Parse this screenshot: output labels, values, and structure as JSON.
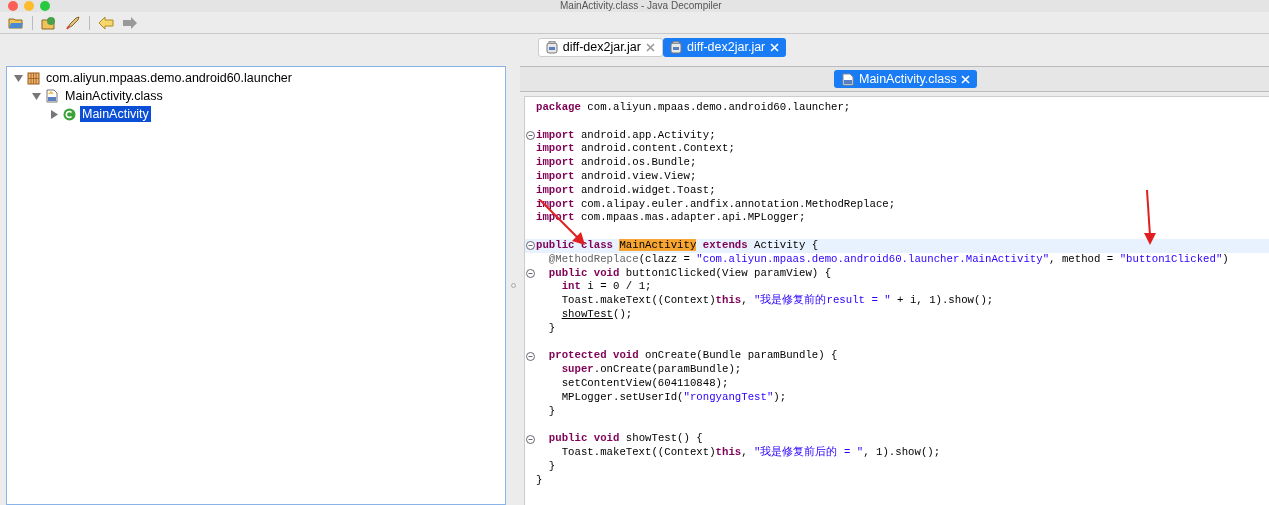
{
  "window": {
    "title": "MainActivity.class - Java Decompiler"
  },
  "file_tabs": [
    {
      "label": "diff-dex2jar.jar",
      "selected": false
    },
    {
      "label": "diff-dex2jar.jar",
      "selected": true
    }
  ],
  "tree": [
    {
      "label": "com.aliyun.mpaas.demo.android60.launcher",
      "kind": "package",
      "expanded": true,
      "selected": false,
      "children": [
        {
          "label": "MainActivity.class",
          "kind": "classfile",
          "expanded": true,
          "selected": false,
          "children": [
            {
              "label": "MainActivity",
              "kind": "class",
              "expanded": false,
              "selected": true
            }
          ]
        }
      ]
    }
  ],
  "editor_tabs": [
    {
      "label": "MainActivity.class",
      "selected": true
    }
  ],
  "code": [
    {
      "fold": false,
      "current": false,
      "tokens": [
        {
          "kind": "keyword",
          "text": "package"
        },
        {
          "kind": "plain",
          "text": " com.aliyun.mpaas.demo.android60.launcher;"
        }
      ]
    },
    {
      "fold": false,
      "current": false
    },
    {
      "fold": true,
      "current": false,
      "tokens": [
        {
          "kind": "keyword",
          "text": "import"
        },
        {
          "kind": "plain",
          "text": " android.app.Activity;"
        }
      ]
    },
    {
      "fold": false,
      "current": false,
      "tokens": [
        {
          "kind": "keyword",
          "text": "import"
        },
        {
          "kind": "plain",
          "text": " android.content.Context;"
        }
      ]
    },
    {
      "fold": false,
      "current": false,
      "tokens": [
        {
          "kind": "keyword",
          "text": "import"
        },
        {
          "kind": "plain",
          "text": " android.os.Bundle;"
        }
      ]
    },
    {
      "fold": false,
      "current": false,
      "tokens": [
        {
          "kind": "keyword",
          "text": "import"
        },
        {
          "kind": "plain",
          "text": " android.view.View;"
        }
      ]
    },
    {
      "fold": false,
      "current": false,
      "tokens": [
        {
          "kind": "keyword",
          "text": "import"
        },
        {
          "kind": "plain",
          "text": " android.widget.Toast;"
        }
      ]
    },
    {
      "fold": false,
      "current": false,
      "tokens": [
        {
          "kind": "keyword",
          "text": "import"
        },
        {
          "kind": "plain",
          "text": " com.alipay.euler.andfix.annotation.MethodReplace;"
        }
      ]
    },
    {
      "fold": false,
      "current": false,
      "tokens": [
        {
          "kind": "keyword",
          "text": "import"
        },
        {
          "kind": "plain",
          "text": " com.mpaas.mas.adapter.api.MPLogger;"
        }
      ]
    },
    {
      "fold": false,
      "current": false
    },
    {
      "fold": true,
      "current": true,
      "tokens": [
        {
          "kind": "keyword",
          "text": "public class "
        },
        {
          "kind": "highlight",
          "text": "MainActivity"
        },
        {
          "kind": "keyword",
          "text": " extends"
        },
        {
          "kind": "plain",
          "text": " Activity {"
        }
      ]
    },
    {
      "fold": false,
      "current": false,
      "tokens": [
        {
          "kind": "annotation",
          "text": "  @MethodReplace"
        },
        {
          "kind": "plain",
          "text": "(clazz = "
        },
        {
          "kind": "string",
          "text": "\"com.aliyun.mpaas.demo.android60.launcher.MainActivity\""
        },
        {
          "kind": "plain",
          "text": ", method = "
        },
        {
          "kind": "string",
          "text": "\"button1Clicked\""
        },
        {
          "kind": "plain",
          "text": ")"
        }
      ]
    },
    {
      "fold": true,
      "current": false,
      "tokens": [
        {
          "kind": "keyword",
          "text": "  public void"
        },
        {
          "kind": "plain",
          "text": " button1Clicked(View paramView) {"
        }
      ]
    },
    {
      "fold": false,
      "current": false,
      "tokens": [
        {
          "kind": "keyword",
          "text": "    int"
        },
        {
          "kind": "plain",
          "text": " i = 0 / 1;"
        }
      ]
    },
    {
      "fold": false,
      "current": false,
      "tokens": [
        {
          "kind": "plain",
          "text": "    Toast.makeText((Context)"
        },
        {
          "kind": "keyword",
          "text": "this"
        },
        {
          "kind": "plain",
          "text": ", "
        },
        {
          "kind": "string",
          "text": "\"我是修复前的result = \""
        },
        {
          "kind": "plain",
          "text": " + i, 1).show();"
        }
      ]
    },
    {
      "fold": false,
      "current": false,
      "tokens": [
        {
          "kind": "underline",
          "text": "    showTest"
        },
        {
          "kind": "plain",
          "text": "();"
        }
      ]
    },
    {
      "fold": false,
      "current": false,
      "tokens": [
        {
          "kind": "plain",
          "text": "  }"
        }
      ]
    },
    {
      "fold": false,
      "current": false
    },
    {
      "fold": true,
      "current": false,
      "tokens": [
        {
          "kind": "keyword",
          "text": "  protected void"
        },
        {
          "kind": "plain",
          "text": " onCreate(Bundle paramBundle) {"
        }
      ]
    },
    {
      "fold": false,
      "current": false,
      "tokens": [
        {
          "kind": "keyword",
          "text": "    super"
        },
        {
          "kind": "plain",
          "text": ".onCreate(paramBundle);"
        }
      ]
    },
    {
      "fold": false,
      "current": false,
      "tokens": [
        {
          "kind": "plain",
          "text": "    setContentView(604110848);"
        }
      ]
    },
    {
      "fold": false,
      "current": false,
      "tokens": [
        {
          "kind": "plain",
          "text": "    MPLogger.setUserId("
        },
        {
          "kind": "string",
          "text": "\"rongyangTest\""
        },
        {
          "kind": "plain",
          "text": ");"
        }
      ]
    },
    {
      "fold": false,
      "current": false,
      "tokens": [
        {
          "kind": "plain",
          "text": "  }"
        }
      ]
    },
    {
      "fold": false,
      "current": false
    },
    {
      "fold": true,
      "current": false,
      "tokens": [
        {
          "kind": "keyword",
          "text": "  public void"
        },
        {
          "kind": "plain",
          "text": " showTest() {"
        }
      ]
    },
    {
      "fold": false,
      "current": false,
      "tokens": [
        {
          "kind": "plain",
          "text": "    Toast.makeText((Context)"
        },
        {
          "kind": "keyword",
          "text": "this"
        },
        {
          "kind": "plain",
          "text": ", "
        },
        {
          "kind": "string",
          "text": "\"我是修复前后的 = \""
        },
        {
          "kind": "plain",
          "text": ", 1).show();"
        }
      ]
    },
    {
      "fold": false,
      "current": false,
      "tokens": [
        {
          "kind": "plain",
          "text": "  }"
        }
      ]
    },
    {
      "fold": false,
      "current": false,
      "tokens": [
        {
          "kind": "plain",
          "text": "}"
        }
      ]
    }
  ]
}
